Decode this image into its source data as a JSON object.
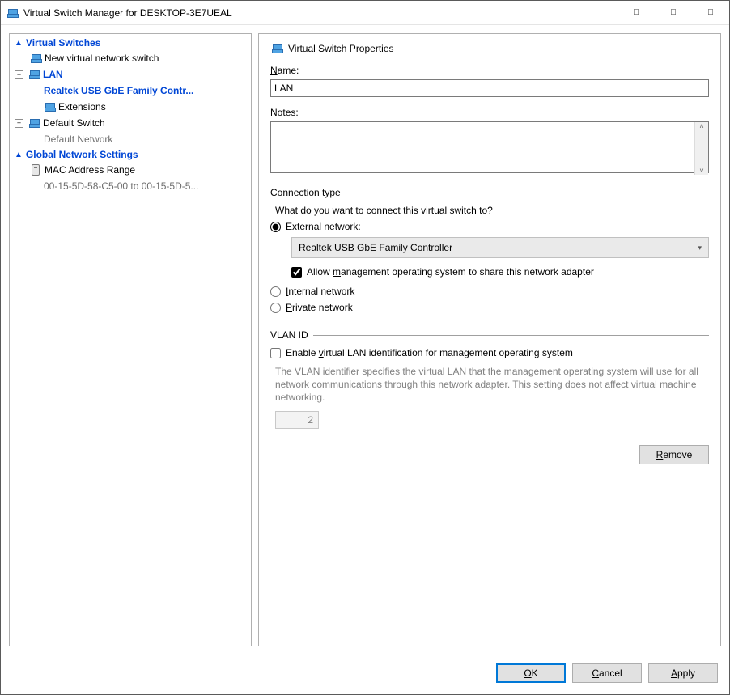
{
  "window": {
    "title": "Virtual Switch Manager for DESKTOP-3E7UEAL"
  },
  "tree": {
    "section1": "Virtual Switches",
    "new_switch": "New virtual network switch",
    "lan": "LAN",
    "lan_adapter": "Realtek USB GbE Family Contr...",
    "extensions": "Extensions",
    "default_switch": "Default Switch",
    "default_network": "Default Network",
    "section2": "Global Network Settings",
    "mac_range": "MAC Address Range",
    "mac_range_value": "00-15-5D-58-C5-00 to 00-15-5D-5..."
  },
  "props": {
    "heading": "Virtual Switch Properties",
    "name_label": "Name:",
    "name_value": "LAN",
    "notes_label": "Notes:",
    "notes_value": "",
    "conn": {
      "group_title": "Connection type",
      "question": "What do you want to connect this virtual switch to?",
      "external": "External network:",
      "adapter": "Realtek USB GbE Family Controller",
      "allow_mgmt": "Allow management operating system to share this network adapter",
      "internal": "Internal network",
      "private": "Private network"
    },
    "vlan": {
      "group_title": "VLAN ID",
      "enable": "Enable virtual LAN identification for management operating system",
      "desc": "The VLAN identifier specifies the virtual LAN that the management operating system will use for all network communications through this network adapter. This setting does not affect virtual machine networking.",
      "value": "2"
    },
    "remove": "Remove"
  },
  "buttons": {
    "ok": "OK",
    "cancel": "Cancel",
    "apply": "Apply"
  }
}
